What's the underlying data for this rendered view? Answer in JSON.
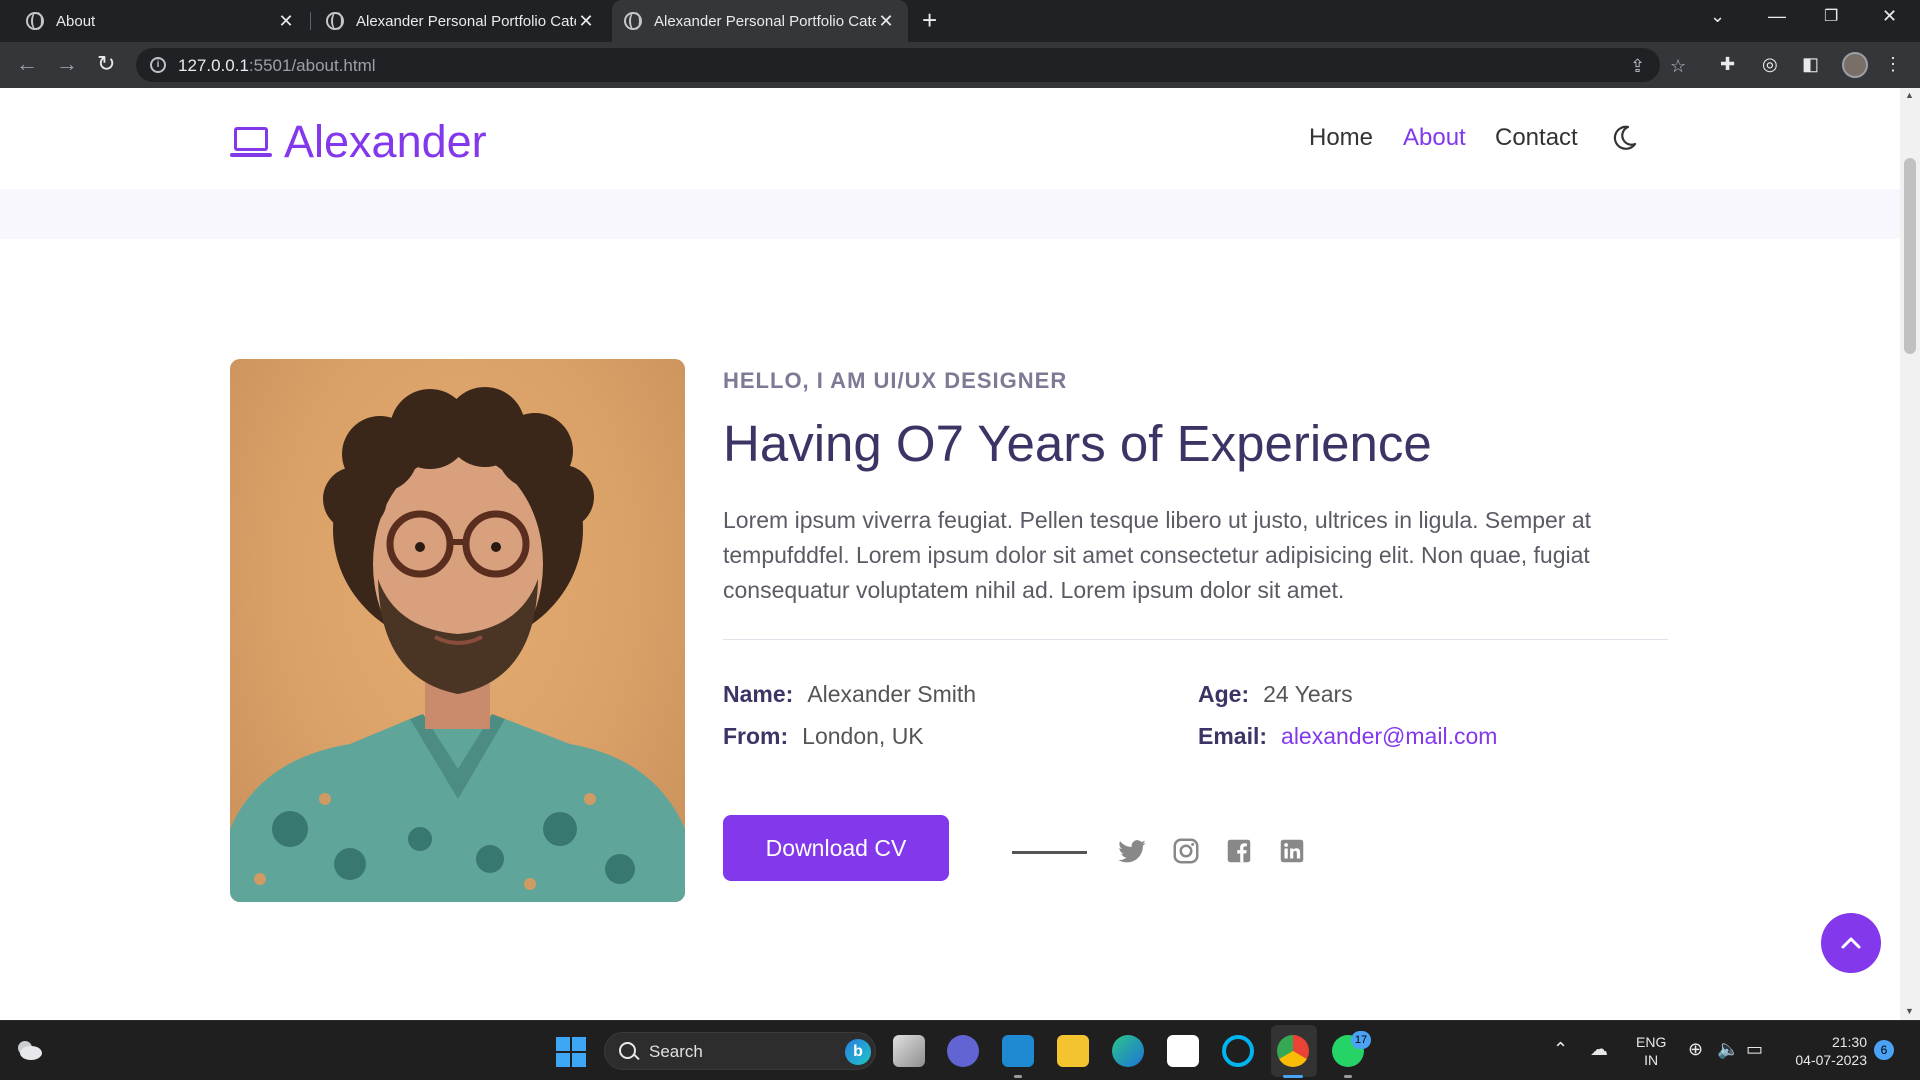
{
  "browser": {
    "tabs": [
      {
        "title": "About"
      },
      {
        "title": "Alexander Personal Portfolio Category"
      },
      {
        "title": "Alexander Personal Portfolio Category"
      }
    ],
    "url_host": "127.0.0.1",
    "url_rest": ":5501/about.html"
  },
  "site": {
    "brand": "Alexander",
    "nav": [
      {
        "label": "Home"
      },
      {
        "label": "About"
      },
      {
        "label": "Contact"
      }
    ],
    "active_nav": "About",
    "accent_color": "#8338ec"
  },
  "about": {
    "kicker": "HELLO, I AM UI/UX DESIGNER",
    "heading": "Having O7 Years of Experience",
    "lead": "Lorem ipsum viverra feugiat. Pellen tesque libero ut justo, ultrices in ligula. Semper at tempufddfel. Lorem ipsum dolor sit amet consectetur adipisicing elit. Non quae, fugiat consequatur voluptatem nihil ad. Lorem ipsum dolor sit amet.",
    "info": {
      "name_label": "Name:",
      "name_value": "Alexander Smith",
      "age_label": "Age:",
      "age_value": "24 Years",
      "from_label": "From:",
      "from_value": "London, UK",
      "email_label": "Email:",
      "email_value": "alexander@mail.com"
    },
    "cta_label": "Download CV",
    "social_icons": [
      "twitter-icon",
      "instagram-icon",
      "facebook-icon",
      "linkedin-icon"
    ]
  },
  "taskbar": {
    "search_label": "Search",
    "whatsapp_badge": "17",
    "lang_line1": "ENG",
    "lang_line2": "IN",
    "time": "21:30",
    "date": "04-07-2023",
    "notification_count": "6"
  }
}
